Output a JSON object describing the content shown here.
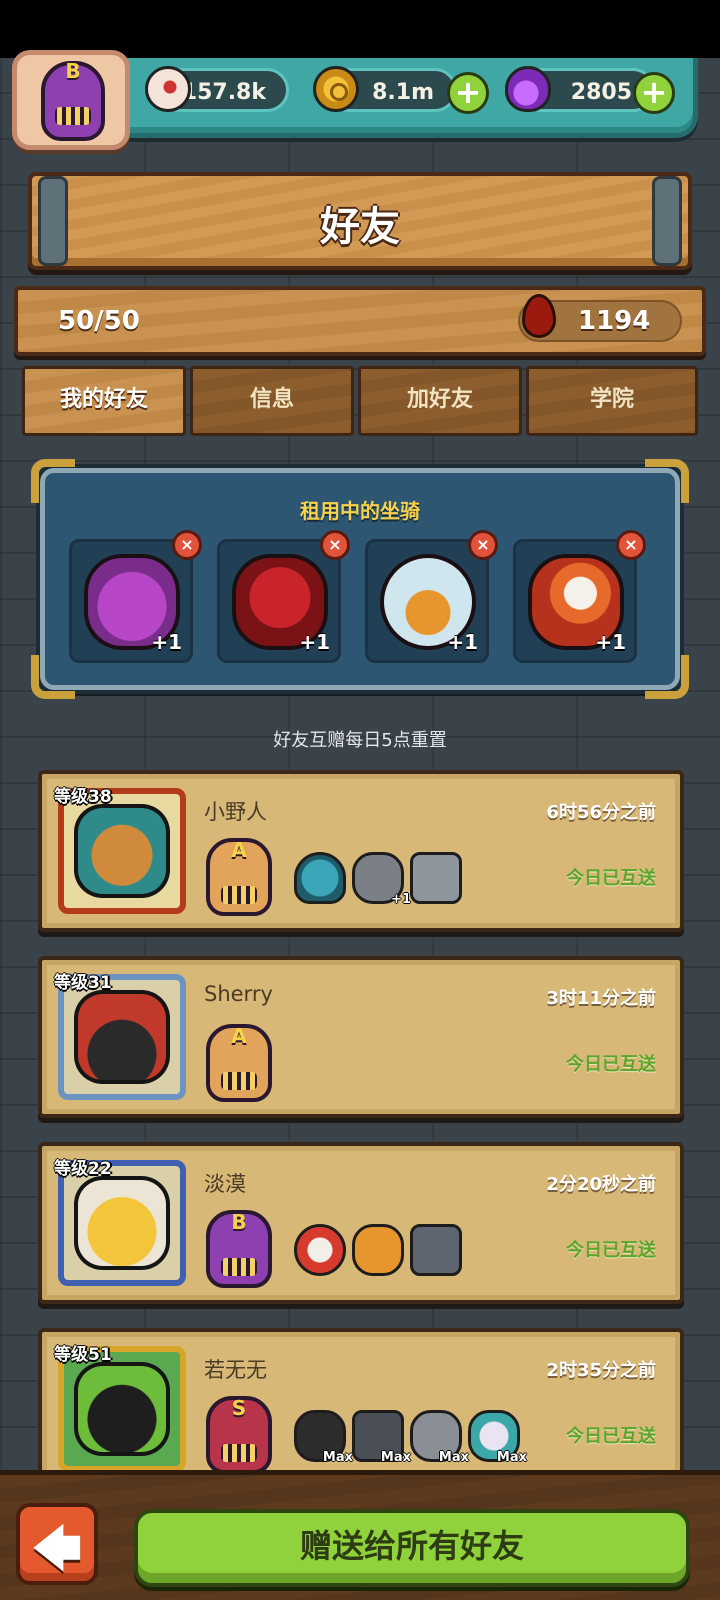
{
  "header": {
    "player_rank": "B",
    "resources": [
      {
        "icon": "eyeball-icon",
        "value": "157.8k"
      },
      {
        "icon": "gold-coin-icon",
        "value": "8.1m"
      },
      {
        "icon": "potion-icon",
        "value": "2805"
      }
    ],
    "plus_symbol": "+"
  },
  "page": {
    "title": "好友"
  },
  "friends_summary": {
    "count": "50/50",
    "blood": "1194"
  },
  "tabs": [
    {
      "label": "我的好友",
      "active": true
    },
    {
      "label": "信息",
      "active": false
    },
    {
      "label": "加好友",
      "active": false
    },
    {
      "label": "学院",
      "active": false
    }
  ],
  "rented_mounts": {
    "title": "租用中的坐骑",
    "remove_symbol": "×",
    "items": [
      {
        "name": "purple-horned-monster-mount",
        "bonus": "+1"
      },
      {
        "name": "red-rose-mount",
        "bonus": "+1"
      },
      {
        "name": "hamster-bubble-mount",
        "bonus": "+1"
      },
      {
        "name": "lion-dance-mount",
        "bonus": "+1"
      }
    ]
  },
  "reset_note": "好友互赠每日5点重置",
  "friends": [
    {
      "level": "等级38",
      "name": "小野人",
      "time": "6时56分之前",
      "status": "今日已互送",
      "rank": "A",
      "mounts": [
        {
          "label": ""
        },
        {
          "label": "+1"
        },
        {
          "label": ""
        }
      ]
    },
    {
      "level": "等级31",
      "name": "Sherry",
      "time": "3时11分之前",
      "status": "今日已互送",
      "rank": "A",
      "mounts": []
    },
    {
      "level": "等级22",
      "name": "淡漠",
      "time": "2分20秒之前",
      "status": "今日已互送",
      "rank": "B",
      "mounts": [
        {
          "label": ""
        },
        {
          "label": ""
        },
        {
          "label": ""
        }
      ]
    },
    {
      "level": "等级51",
      "name": "若无无",
      "time": "2时35分之前",
      "status": "今日已互送",
      "rank": "S",
      "mounts": [
        {
          "label": "Max"
        },
        {
          "label": "Max"
        },
        {
          "label": "Max"
        },
        {
          "label": "Max"
        }
      ]
    }
  ],
  "footer": {
    "back_symbol": "🡄",
    "send_all_label": "赠送给所有好友"
  },
  "colors": {
    "primary_button": "#8fd23b",
    "status_green": "#5aa52a",
    "gold_text": "#f5d24a",
    "panel_blue": "#2d5673"
  }
}
